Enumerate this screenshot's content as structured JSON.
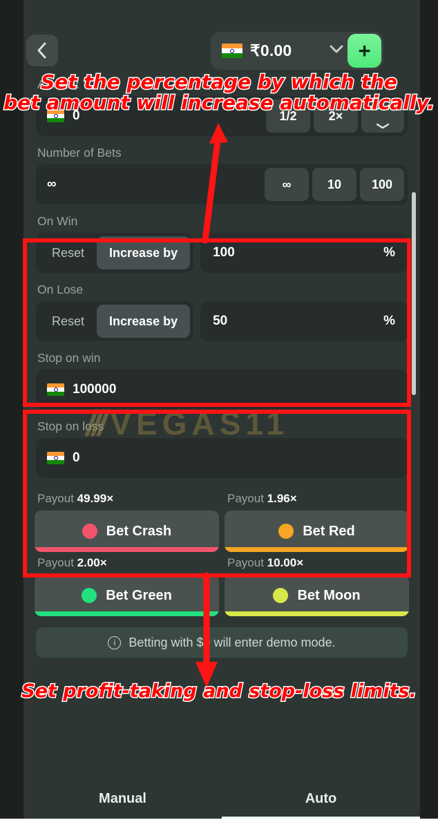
{
  "header": {
    "back_icon": "chevron-left-icon",
    "currency_flag": "india-flag",
    "balance": "₹0.00",
    "dropdown_icon": "chevron-down-icon",
    "add_label": "+"
  },
  "amount": {
    "label": "Amount",
    "info_icon": "info-icon",
    "value": "0",
    "half_label": "1/2",
    "double_label": "2×",
    "stepper_icon": "stepper-up-down-icon"
  },
  "number_of_bets": {
    "label": "Number of Bets",
    "value": "∞",
    "chips": [
      "∞",
      "10",
      "100"
    ]
  },
  "on_win": {
    "label": "On Win",
    "reset_label": "Reset",
    "increase_label": "Increase by",
    "percent_value": "100",
    "percent_unit": "%"
  },
  "on_lose": {
    "label": "On Lose",
    "reset_label": "Reset",
    "increase_label": "Increase by",
    "percent_value": "50",
    "percent_unit": "%"
  },
  "stop_on_win": {
    "label": "Stop on win",
    "value": "100000"
  },
  "stop_on_loss": {
    "label": "Stop on loss",
    "value": "0"
  },
  "bets": [
    {
      "payout_prefix": "Payout",
      "payout": "49.99×",
      "label": "Bet Crash",
      "color": "#f1556c"
    },
    {
      "payout_prefix": "Payout",
      "payout": "1.96×",
      "label": "Bet Red",
      "color": "#f6a623"
    },
    {
      "payout_prefix": "Payout",
      "payout": "2.00×",
      "label": "Bet Green",
      "color": "#22e07e"
    },
    {
      "payout_prefix": "Payout",
      "payout": "10.00×",
      "label": "Bet Moon",
      "color": "#d8e84a"
    }
  ],
  "notice": {
    "icon": "info-icon",
    "text": "Betting with $0 will enter demo mode."
  },
  "tabs": [
    {
      "label": "Manual",
      "active": false
    },
    {
      "label": "Auto",
      "active": true
    }
  ],
  "watermark": {
    "slash": "///",
    "text": "VEGAS11"
  },
  "annotations": [
    {
      "line1": "Set the percentage by which the",
      "line2": "bet amount will increase automatically."
    },
    {
      "line1": "Set profit-taking and stop-loss limits."
    }
  ],
  "colors": {
    "accent_green": "#4ee97a",
    "annotation_red": "#ff0000",
    "panel": "#2e3634",
    "input": "#262d2c"
  }
}
